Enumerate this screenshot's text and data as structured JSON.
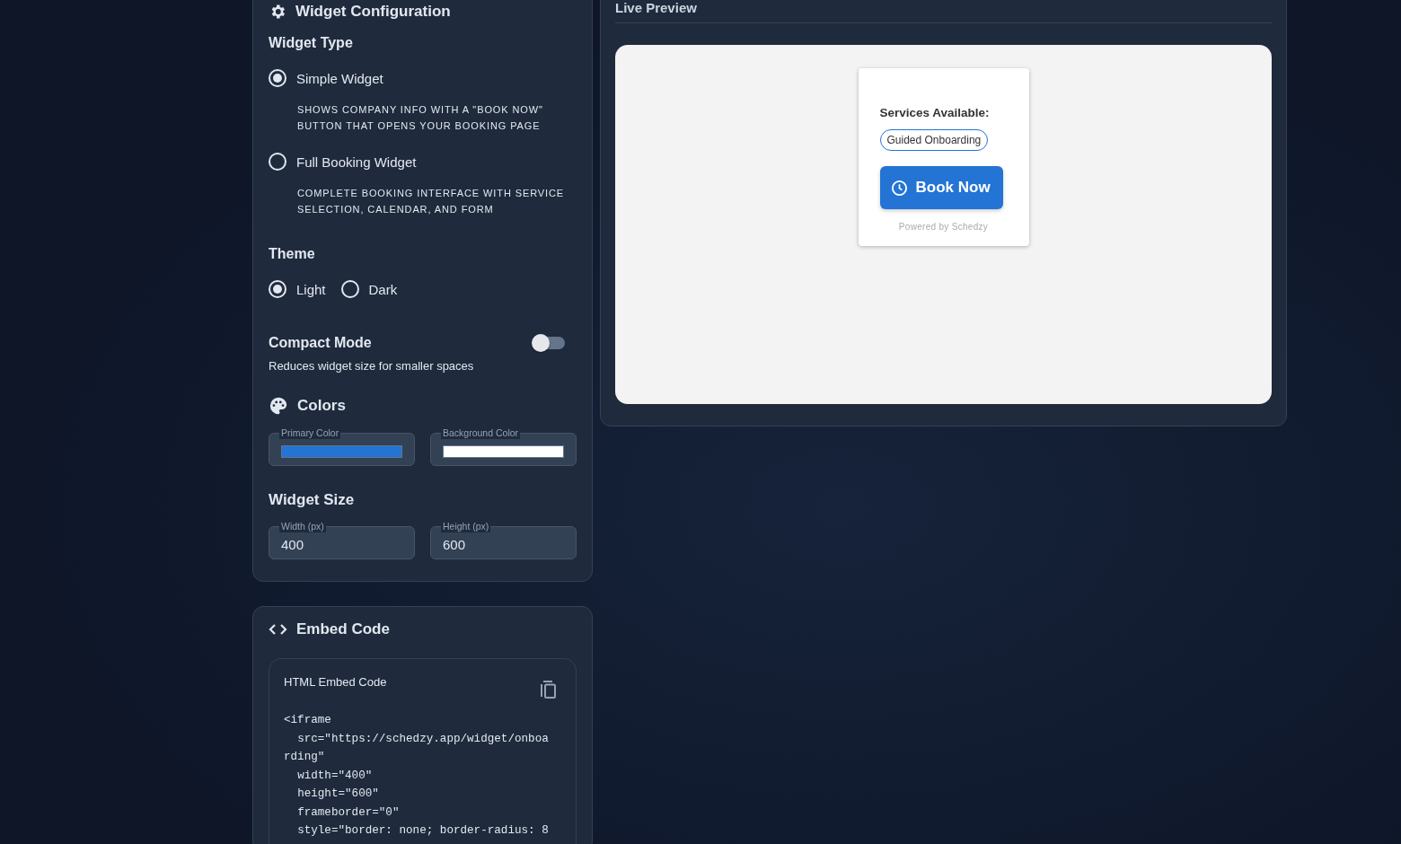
{
  "config": {
    "title": "Widget Configuration",
    "widget_type": {
      "label": "Widget Type",
      "options": [
        {
          "label": "Simple Widget",
          "description": "SHOWS COMPANY INFO WITH A \"BOOK NOW\" BUTTON THAT OPENS YOUR BOOKING PAGE",
          "selected": true
        },
        {
          "label": "Full Booking Widget",
          "description": "COMPLETE BOOKING INTERFACE WITH SERVICE SELECTION, CALENDAR, AND FORM",
          "selected": false
        }
      ]
    },
    "theme": {
      "label": "Theme",
      "options": [
        {
          "label": "Light",
          "selected": true
        },
        {
          "label": "Dark",
          "selected": false
        }
      ]
    },
    "compact_mode": {
      "label": "Compact Mode",
      "description": "Reduces widget size for smaller spaces",
      "on": false
    },
    "colors": {
      "title": "Colors",
      "fields": [
        {
          "label": "Primary Color",
          "color": "#2374d4"
        },
        {
          "label": "Background Color",
          "color": "#ffffff"
        }
      ]
    },
    "size": {
      "title": "Widget Size",
      "fields": [
        {
          "label": "Width (px)",
          "value": "400"
        },
        {
          "label": "Height (px)",
          "value": "600"
        }
      ]
    }
  },
  "embed": {
    "title": "Embed Code",
    "box_title": "HTML Embed Code",
    "code": "<iframe\n  src=\"https://schedzy.app/widget/onboarding\"\n  width=\"400\"\n  height=\"600\"\n  frameborder=\"0\"\n  style=\"border: none; border-radius: 8"
  },
  "preview": {
    "title": "Live Preview",
    "widget": {
      "services_label": "Services Available:",
      "services": [
        "Guided Onboarding"
      ],
      "button": "Book Now",
      "footer": "Powered by Schedzy"
    }
  }
}
